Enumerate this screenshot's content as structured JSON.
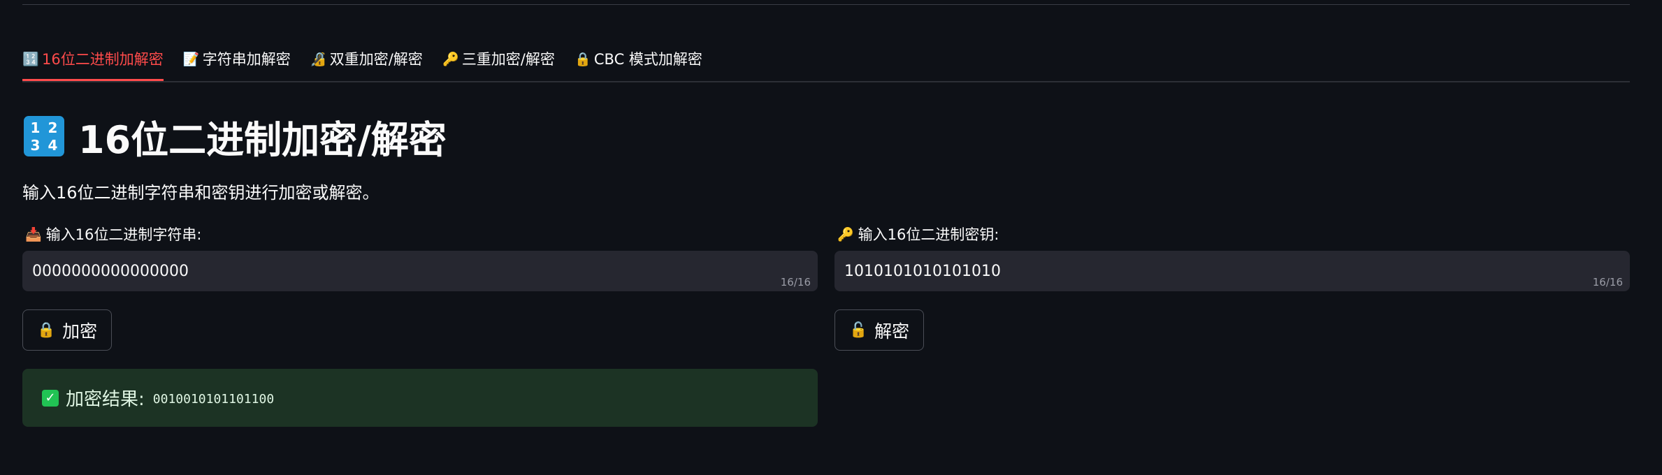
{
  "tabs": [
    {
      "icon": "input-numbers",
      "icon_char": "🔢",
      "label": "16位二进制加解密",
      "active": true
    },
    {
      "icon": "memo",
      "icon_char": "📝",
      "label": "字符串加解密",
      "active": false
    },
    {
      "icon": "lock-with-pen",
      "icon_char": "🔏",
      "label": "双重加密/解密",
      "active": false
    },
    {
      "icon": "key",
      "icon_char": "🔑",
      "label": "三重加密/解密",
      "active": false
    },
    {
      "icon": "lock",
      "icon_char": "🔒",
      "label": "CBC 模式加解密",
      "active": false
    }
  ],
  "page": {
    "title": "16位二进制加密/解密",
    "icon_digits": [
      "1",
      "2",
      "3",
      "4"
    ],
    "subtitle": "输入16位二进制字符串和密钥进行加密或解密。"
  },
  "plaintext_field": {
    "icon": "inbox-tray",
    "icon_char": "📥",
    "label": "输入16位二进制字符串:",
    "value": "0000000000000000",
    "counter": "16/16"
  },
  "key_field": {
    "icon": "key",
    "icon_char": "🔑",
    "label": "输入16位二进制密钥:",
    "value": "1010101010101010",
    "counter": "16/16"
  },
  "buttons": {
    "encrypt": {
      "icon": "lock",
      "icon_char": "🔒",
      "label": "加密"
    },
    "decrypt": {
      "icon": "unlocked",
      "icon_char": "🔓",
      "label": "解密"
    }
  },
  "result": {
    "icon": "check-mark-button",
    "label": "加密结果:",
    "value": "0010010101101100"
  },
  "colors": {
    "background": "#0e1117",
    "accent": "#ff4b4b",
    "input_bg": "#262730",
    "success_bg": "#1c3324",
    "success_icon": "#21c354"
  }
}
